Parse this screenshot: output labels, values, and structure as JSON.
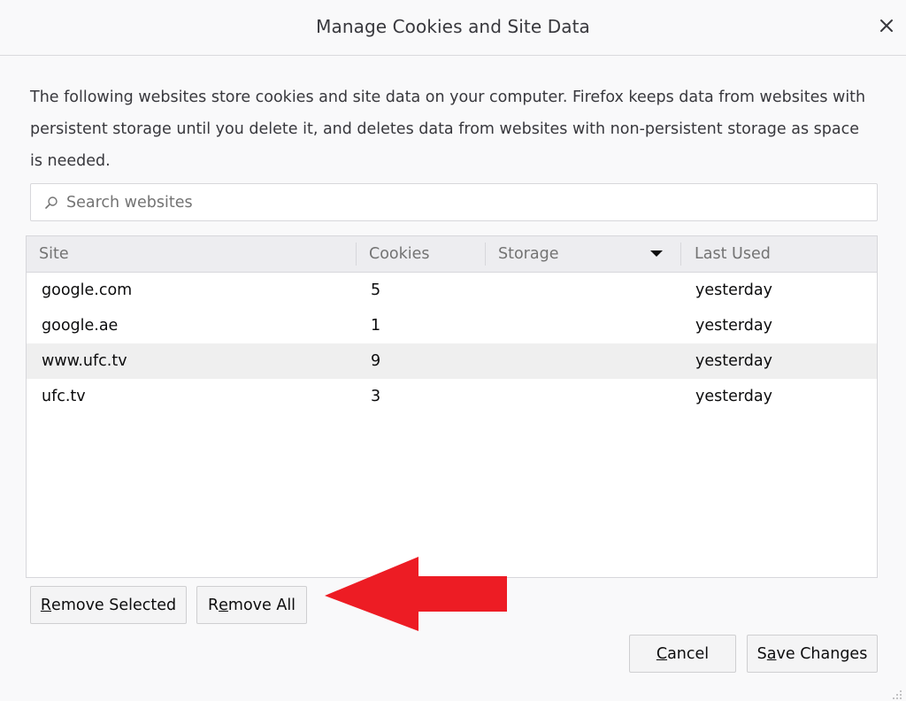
{
  "dialog": {
    "title": "Manage Cookies and Site Data",
    "close_icon": "close-icon",
    "description": "The following websites store cookies and site data on your computer. Firefox keeps data from websites with persistent storage until you delete it, and deletes data from websites with non-persistent storage as space is needed."
  },
  "search": {
    "placeholder": "Search websites",
    "value": "",
    "icon": "search-icon"
  },
  "table": {
    "columns": [
      "Site",
      "Cookies",
      "Storage",
      "Last Used"
    ],
    "sort_icon": "caret-down-icon",
    "rows": [
      {
        "site": "google.com",
        "cookies": "5",
        "storage": "",
        "last_used": "yesterday",
        "selected": false
      },
      {
        "site": "google.ae",
        "cookies": "1",
        "storage": "",
        "last_used": "yesterday",
        "selected": false
      },
      {
        "site": "www.ufc.tv",
        "cookies": "9",
        "storage": "",
        "last_used": "yesterday",
        "selected": true
      },
      {
        "site": "ufc.tv",
        "cookies": "3",
        "storage": "",
        "last_used": "yesterday",
        "selected": false
      }
    ]
  },
  "buttons": {
    "remove_selected": {
      "accesskey": "R",
      "rest": "emove Selected"
    },
    "remove_all": {
      "pre": "R",
      "accesskey": "e",
      "rest": "move All"
    },
    "cancel": {
      "accesskey": "C",
      "rest": "ancel"
    },
    "save_changes": {
      "pre": "S",
      "accesskey": "a",
      "rest": "ve Changes"
    }
  },
  "annotation": {
    "arrow_color": "#ed1c24",
    "arrow_icon": "red-arrow-left-icon"
  }
}
